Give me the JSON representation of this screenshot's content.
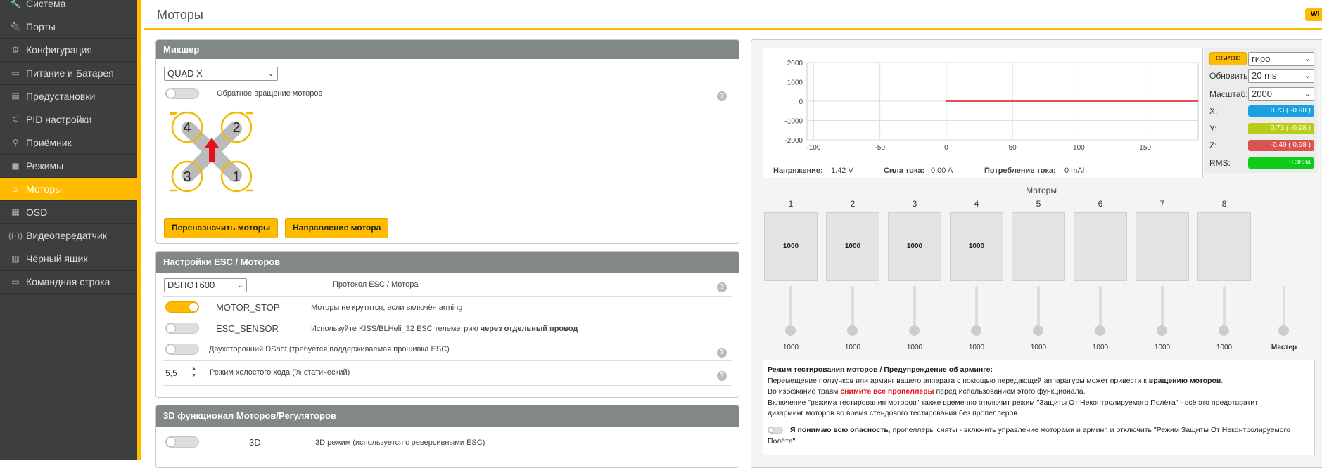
{
  "sidebar": {
    "items": [
      {
        "label": "Система",
        "icon": "wrench-icon",
        "glyph": "🔧"
      },
      {
        "label": "Порты",
        "icon": "plug-icon",
        "glyph": "🔌"
      },
      {
        "label": "Конфигурация",
        "icon": "gear-icon",
        "glyph": "⚙"
      },
      {
        "label": "Питание и Батарея",
        "icon": "battery-icon",
        "glyph": "▭"
      },
      {
        "label": "Предустановки",
        "icon": "presets-icon",
        "glyph": "▤"
      },
      {
        "label": "PID настройки",
        "icon": "sliders-icon",
        "glyph": "⚟"
      },
      {
        "label": "Приёмник",
        "icon": "receiver-icon",
        "glyph": "⚲"
      },
      {
        "label": "Режимы",
        "icon": "modes-icon",
        "glyph": "▣"
      },
      {
        "label": "Моторы",
        "icon": "motor-icon",
        "glyph": "♨"
      },
      {
        "label": "OSD",
        "icon": "osd-icon",
        "glyph": "▦"
      },
      {
        "label": "Видеопередатчик",
        "icon": "vtx-icon",
        "glyph": "((·))"
      },
      {
        "label": "Чёрный ящик",
        "icon": "blackbox-icon",
        "glyph": "▥"
      },
      {
        "label": "Командная строка",
        "icon": "terminal-icon",
        "glyph": "▭"
      }
    ],
    "active_index": 8
  },
  "header": {
    "title": "Моторы",
    "wiki_label": "WI"
  },
  "mixer": {
    "title": "Микшер",
    "mixer_type": "QUAD X",
    "reverse_label": "Обратное вращение моторов",
    "reverse_on": false,
    "motor_labels": [
      "4",
      "2",
      "3",
      "1"
    ],
    "remap_button": "Переназначить моторы",
    "direction_button": "Направление мотора"
  },
  "esc": {
    "title": "Настройки ESC / Моторов",
    "protocol": "DSHOT600",
    "protocol_label": "Протокол ESC / Мотора",
    "motor_stop_name": "MOTOR_STOP",
    "motor_stop_desc": "Моторы не крутятся, если включён arming",
    "motor_stop_on": true,
    "esc_sensor_name": "ESC_SENSOR",
    "esc_sensor_desc": "Используйте KISS/BLHeli_32 ESC телеметрию",
    "esc_sensor_desc_bold": "через отдельный провод",
    "esc_sensor_on": false,
    "bidir_label": "Двухсторонний DShot (требуется поддерживаемая прошивка ESC)",
    "bidir_on": false,
    "idle_value": "5,5",
    "idle_label": "Режим холостого хода (% статический)"
  },
  "threed": {
    "title": "3D функционал Моторов/Регуляторов",
    "name": "3D",
    "desc": "3D режим (используется с реверсивными ESC)",
    "on": false
  },
  "graph": {
    "reset_label": "СБРОС",
    "sensor": "гиро",
    "refresh_label": "Обновить:",
    "refresh_value": "20 ms",
    "scale_label": "Масштаб:",
    "scale_value": "2000",
    "axes": [
      {
        "label": "X:",
        "value": "0.73 ( -0.98 )",
        "color": "#1ba1e2"
      },
      {
        "label": "Y:",
        "value": "0.73 ( -0.98 )",
        "color": "#b8cc1a"
      },
      {
        "label": "Z:",
        "value": "-0.49 ( 0.98 )",
        "color": "#d9534f"
      },
      {
        "label": "RMS:",
        "value": "0.3634",
        "color": "#0ccc17"
      }
    ],
    "y_ticks": [
      "2000",
      "1000",
      "0",
      "-1000",
      "-2000"
    ],
    "x_ticks": [
      "-100",
      "-50",
      "0",
      "50",
      "100",
      "150"
    ],
    "voltage_label": "Напряжение:",
    "voltage": "1.42 V",
    "current_label": "Сила тока:",
    "current": "0.00 A",
    "consumption_label": "Потребление тока:",
    "consumption": "0 mAh"
  },
  "chart_data": {
    "type": "line",
    "x": [
      0,
      190
    ],
    "series": [
      {
        "values": [
          0,
          0
        ],
        "color": "#e2111c"
      }
    ],
    "xlim": [
      -105,
      190
    ],
    "ylim": [
      -2000,
      2000
    ],
    "grid": true
  },
  "motors": {
    "title": "Моторы",
    "numbers": [
      "1",
      "2",
      "3",
      "4",
      "5",
      "6",
      "7",
      "8"
    ],
    "box_values": [
      "1000",
      "1000",
      "1000",
      "1000",
      "",
      "",
      "",
      ""
    ],
    "slider_values": [
      "1000",
      "1000",
      "1000",
      "1000",
      "1000",
      "1000",
      "1000",
      "1000"
    ],
    "master_label": "Мастер"
  },
  "warning": {
    "title": "Режим тестирования моторов / Предупреждение об арминге:",
    "line1": "Перемещение ползунков или арминг вашего аппарата с помощью передающей аппаратуры может привести к ",
    "line1_bold": "вращению моторов",
    "line1_end": ".",
    "line2_start": "Во избежание травм ",
    "line2_red": "снимите все пропеллеры",
    "line2_end": " перед использованием этого функционала.",
    "line3": "Включение \"режима тестирования моторов\" также временно отключит режим \"Защиты От Неконтролируемого Полёта\" - всё это предотвратит",
    "line4": "дизарминг моторов во время стендового тестирования без пропеллеров.",
    "ack_bold": "Я понимаю всю опасность",
    "ack_rest": ", пропеллеры сняты - включить управление моторами и арминг, и отключить \"Режим Защиты От Неконтролируемого",
    "ack_end": "Полёта\"."
  }
}
